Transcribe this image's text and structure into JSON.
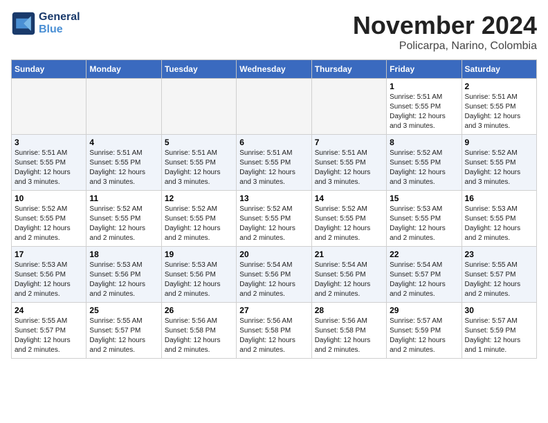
{
  "logo": {
    "line1": "General",
    "line2": "Blue"
  },
  "header": {
    "month": "November 2024",
    "location": "Policarpa, Narino, Colombia"
  },
  "weekdays": [
    "Sunday",
    "Monday",
    "Tuesday",
    "Wednesday",
    "Thursday",
    "Friday",
    "Saturday"
  ],
  "weeks": [
    [
      {
        "day": "",
        "info": ""
      },
      {
        "day": "",
        "info": ""
      },
      {
        "day": "",
        "info": ""
      },
      {
        "day": "",
        "info": ""
      },
      {
        "day": "",
        "info": ""
      },
      {
        "day": "1",
        "info": "Sunrise: 5:51 AM\nSunset: 5:55 PM\nDaylight: 12 hours\nand 3 minutes."
      },
      {
        "day": "2",
        "info": "Sunrise: 5:51 AM\nSunset: 5:55 PM\nDaylight: 12 hours\nand 3 minutes."
      }
    ],
    [
      {
        "day": "3",
        "info": "Sunrise: 5:51 AM\nSunset: 5:55 PM\nDaylight: 12 hours\nand 3 minutes."
      },
      {
        "day": "4",
        "info": "Sunrise: 5:51 AM\nSunset: 5:55 PM\nDaylight: 12 hours\nand 3 minutes."
      },
      {
        "day": "5",
        "info": "Sunrise: 5:51 AM\nSunset: 5:55 PM\nDaylight: 12 hours\nand 3 minutes."
      },
      {
        "day": "6",
        "info": "Sunrise: 5:51 AM\nSunset: 5:55 PM\nDaylight: 12 hours\nand 3 minutes."
      },
      {
        "day": "7",
        "info": "Sunrise: 5:51 AM\nSunset: 5:55 PM\nDaylight: 12 hours\nand 3 minutes."
      },
      {
        "day": "8",
        "info": "Sunrise: 5:52 AM\nSunset: 5:55 PM\nDaylight: 12 hours\nand 3 minutes."
      },
      {
        "day": "9",
        "info": "Sunrise: 5:52 AM\nSunset: 5:55 PM\nDaylight: 12 hours\nand 3 minutes."
      }
    ],
    [
      {
        "day": "10",
        "info": "Sunrise: 5:52 AM\nSunset: 5:55 PM\nDaylight: 12 hours\nand 2 minutes."
      },
      {
        "day": "11",
        "info": "Sunrise: 5:52 AM\nSunset: 5:55 PM\nDaylight: 12 hours\nand 2 minutes."
      },
      {
        "day": "12",
        "info": "Sunrise: 5:52 AM\nSunset: 5:55 PM\nDaylight: 12 hours\nand 2 minutes."
      },
      {
        "day": "13",
        "info": "Sunrise: 5:52 AM\nSunset: 5:55 PM\nDaylight: 12 hours\nand 2 minutes."
      },
      {
        "day": "14",
        "info": "Sunrise: 5:52 AM\nSunset: 5:55 PM\nDaylight: 12 hours\nand 2 minutes."
      },
      {
        "day": "15",
        "info": "Sunrise: 5:53 AM\nSunset: 5:55 PM\nDaylight: 12 hours\nand 2 minutes."
      },
      {
        "day": "16",
        "info": "Sunrise: 5:53 AM\nSunset: 5:55 PM\nDaylight: 12 hours\nand 2 minutes."
      }
    ],
    [
      {
        "day": "17",
        "info": "Sunrise: 5:53 AM\nSunset: 5:56 PM\nDaylight: 12 hours\nand 2 minutes."
      },
      {
        "day": "18",
        "info": "Sunrise: 5:53 AM\nSunset: 5:56 PM\nDaylight: 12 hours\nand 2 minutes."
      },
      {
        "day": "19",
        "info": "Sunrise: 5:53 AM\nSunset: 5:56 PM\nDaylight: 12 hours\nand 2 minutes."
      },
      {
        "day": "20",
        "info": "Sunrise: 5:54 AM\nSunset: 5:56 PM\nDaylight: 12 hours\nand 2 minutes."
      },
      {
        "day": "21",
        "info": "Sunrise: 5:54 AM\nSunset: 5:56 PM\nDaylight: 12 hours\nand 2 minutes."
      },
      {
        "day": "22",
        "info": "Sunrise: 5:54 AM\nSunset: 5:57 PM\nDaylight: 12 hours\nand 2 minutes."
      },
      {
        "day": "23",
        "info": "Sunrise: 5:55 AM\nSunset: 5:57 PM\nDaylight: 12 hours\nand 2 minutes."
      }
    ],
    [
      {
        "day": "24",
        "info": "Sunrise: 5:55 AM\nSunset: 5:57 PM\nDaylight: 12 hours\nand 2 minutes."
      },
      {
        "day": "25",
        "info": "Sunrise: 5:55 AM\nSunset: 5:57 PM\nDaylight: 12 hours\nand 2 minutes."
      },
      {
        "day": "26",
        "info": "Sunrise: 5:56 AM\nSunset: 5:58 PM\nDaylight: 12 hours\nand 2 minutes."
      },
      {
        "day": "27",
        "info": "Sunrise: 5:56 AM\nSunset: 5:58 PM\nDaylight: 12 hours\nand 2 minutes."
      },
      {
        "day": "28",
        "info": "Sunrise: 5:56 AM\nSunset: 5:58 PM\nDaylight: 12 hours\nand 2 minutes."
      },
      {
        "day": "29",
        "info": "Sunrise: 5:57 AM\nSunset: 5:59 PM\nDaylight: 12 hours\nand 2 minutes."
      },
      {
        "day": "30",
        "info": "Sunrise: 5:57 AM\nSunset: 5:59 PM\nDaylight: 12 hours\nand 1 minute."
      }
    ]
  ]
}
